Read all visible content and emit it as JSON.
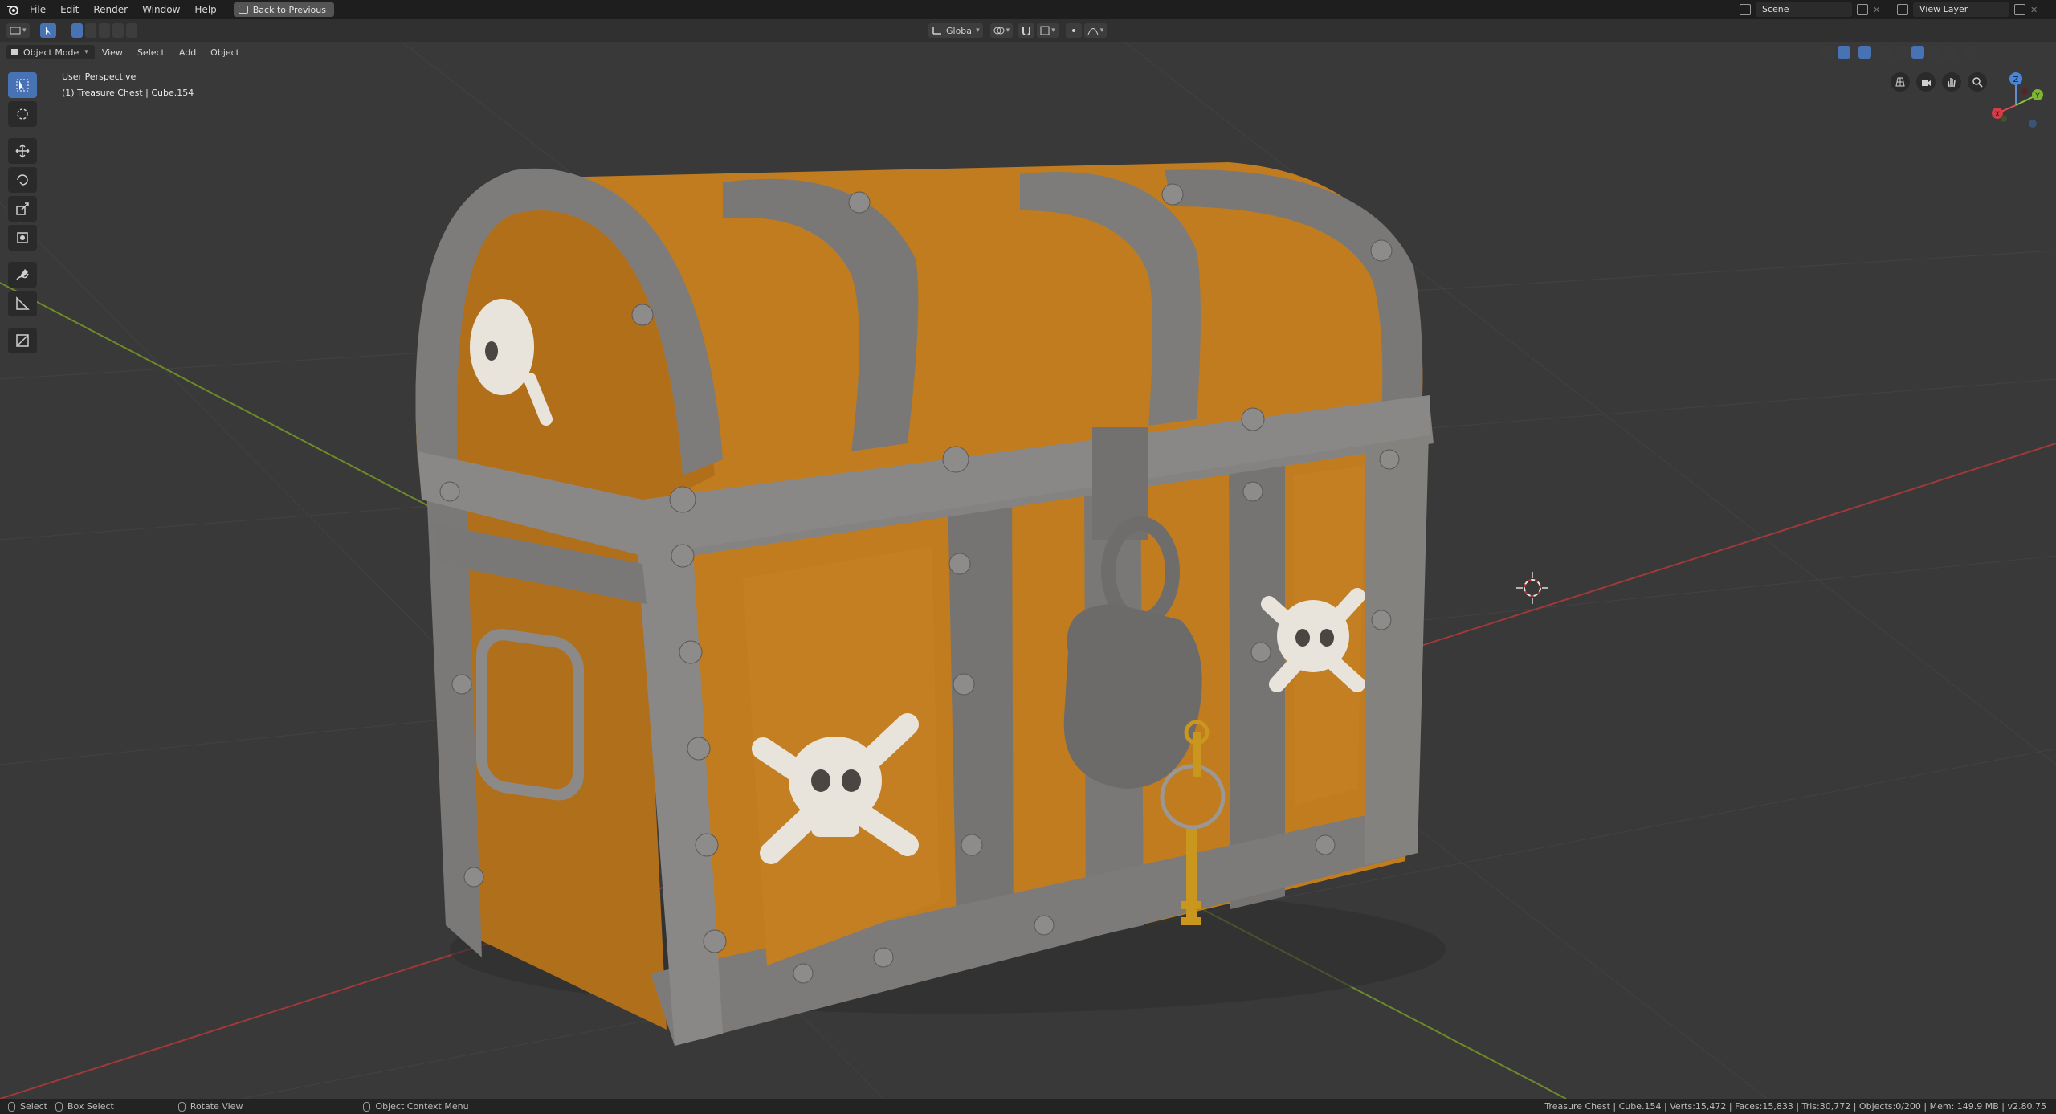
{
  "menubar": {
    "items": [
      "File",
      "Edit",
      "Render",
      "Window",
      "Help"
    ],
    "back_button": "Back to Previous",
    "scene_name": "Scene",
    "view_layer": "View Layer"
  },
  "header": {
    "orientation": "Global"
  },
  "mode_row": {
    "mode": "Object Mode",
    "menus": [
      "View",
      "Select",
      "Add",
      "Object"
    ]
  },
  "viewport": {
    "perspective": "User Perspective",
    "active_object": "(1) Treasure Chest | Cube.154",
    "colors": {
      "background": "#393939",
      "wood": "#c07c1f",
      "metal": "#7a7876",
      "x_axis": "#a0393a",
      "y_axis": "#6d8a2a",
      "skull": "#e8e4dc",
      "key": "#c9961e"
    }
  },
  "toolbar": {
    "tools": [
      "select-box-icon",
      "cursor-icon",
      "move-icon",
      "rotate-icon",
      "scale-icon",
      "transform-icon",
      "annotate-icon",
      "measure-icon",
      "add-cube-icon"
    ]
  },
  "gizmo": {
    "z": "Z",
    "y": "Y",
    "x": "X"
  },
  "statusbar": {
    "select": "Select",
    "box_select": "Box Select",
    "rotate_view": "Rotate View",
    "context_menu": "Object Context Menu",
    "stats": "Treasure Chest | Cube.154 | Verts:15,472 | Faces:15,833 | Tris:30,772 | Objects:0/200 | Mem: 149.9 MB | v2.80.75"
  }
}
